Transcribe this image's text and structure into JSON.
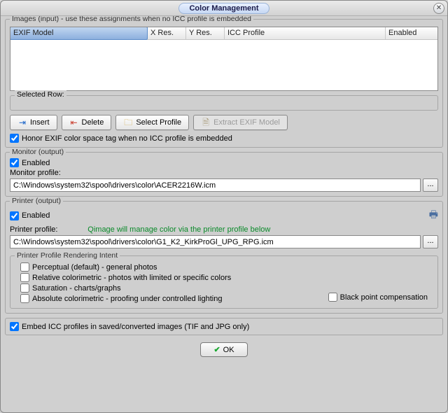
{
  "title": "Color Management",
  "images_group_legend": "Images (input) - use these assignments when no ICC profile is embedded",
  "columns": {
    "c0": "EXIF Model",
    "c1": "X Res.",
    "c2": "Y Res.",
    "c3": "ICC Profile",
    "c4": "Enabled"
  },
  "selected_row_legend": "Selected Row:",
  "buttons": {
    "insert": "Insert",
    "delete": "Delete",
    "select_profile": "Select Profile",
    "extract_exif": "Extract EXIF Model"
  },
  "honor_exif_label": "Honor EXIF color space tag when no ICC profile is embedded",
  "monitor": {
    "legend": "Monitor (output)",
    "enabled_label": "Enabled",
    "profile_label": "Monitor profile:",
    "profile_path": "C:\\Windows\\system32\\spool\\drivers\\color\\ACER2216W.icm"
  },
  "printer": {
    "legend": "Printer (output)",
    "enabled_label": "Enabled",
    "profile_label": "Printer profile:",
    "hint": "Qimage will manage color via the printer profile below",
    "profile_path": "C:\\Windows\\system32\\spool\\drivers\\color\\G1_K2_KirkProGl_UPG_RPG.icm",
    "intent_legend": "Printer Profile Rendering Intent",
    "intents": {
      "perceptual": "Perceptual (default) - general photos",
      "relative": "Relative colorimetric - photos with limited or specific colors",
      "saturation": "Saturation - charts/graphs",
      "absolute": "Absolute colorimetric - proofing under controlled lighting"
    },
    "bpc_label": "Black point compensation"
  },
  "embed_icc_label": "Embed ICC profiles in saved/converted images (TIF and JPG only)",
  "ok_label": "OK",
  "browse_label": "..."
}
